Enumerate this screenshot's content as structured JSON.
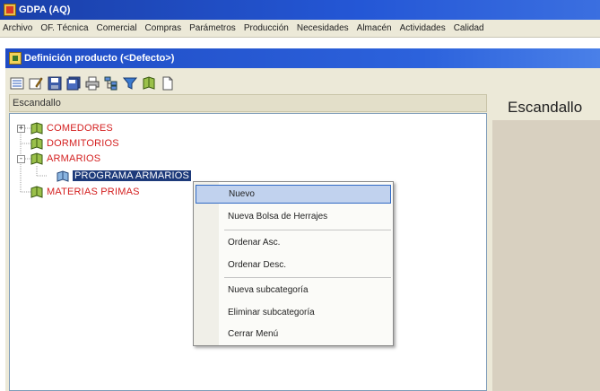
{
  "app": {
    "title": "GDPA (AQ)"
  },
  "menubar": {
    "items": [
      "Archivo",
      "OF. Técnica",
      "Comercial",
      "Compras",
      "Parámetros",
      "Producción",
      "Necesidades",
      "Almacén",
      "Actividades",
      "Calidad"
    ]
  },
  "window": {
    "title": "Definición producto (<Defecto>)"
  },
  "toolbar": {
    "icons": [
      "list-icon",
      "edit-icon",
      "save-icon",
      "save-all-icon",
      "print-icon",
      "tree-icon",
      "filter-icon",
      "book-icon",
      "document-icon"
    ]
  },
  "tree_panel": {
    "header": "Escandallo"
  },
  "right_panel": {
    "header": "Escandallo"
  },
  "tree": {
    "nodes": [
      {
        "label": "COMEDORES",
        "level": 0,
        "expander": "+"
      },
      {
        "label": "DORMITORIOS",
        "level": 0,
        "expander": ""
      },
      {
        "label": "ARMARIOS",
        "level": 0,
        "expander": "-"
      },
      {
        "label": "PROGRAMA ARMARIOS",
        "level": 1,
        "expander": "",
        "selected": true
      },
      {
        "label": "MATERIAS PRIMAS",
        "level": 0,
        "expander": ""
      }
    ]
  },
  "context_menu": {
    "items": [
      {
        "label": "Nuevo",
        "hover": true
      },
      {
        "label": "Nueva Bolsa de Herrajes"
      },
      {
        "label": "Ordenar Asc."
      },
      {
        "label": "Ordenar Desc."
      },
      {
        "label": "Nueva subcategoría"
      },
      {
        "label": "Eliminar subcategoría"
      },
      {
        "label": "Cerrar Menú"
      }
    ]
  },
  "colors": {
    "tree_text": "#d42020",
    "selection": "#1d3a7a",
    "titlebar": "#2457d6",
    "menu_hover": "#c1d2ee"
  }
}
